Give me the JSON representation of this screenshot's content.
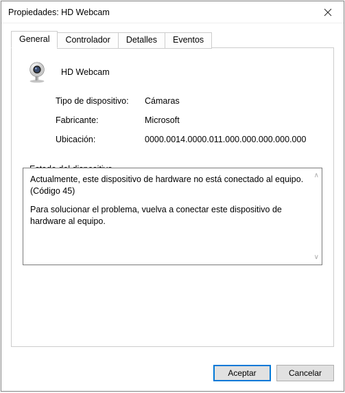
{
  "window": {
    "title": "Propiedades: HD Webcam"
  },
  "tabs": {
    "general": "General",
    "controller": "Controlador",
    "details": "Detalles",
    "events": "Eventos"
  },
  "device": {
    "name": "HD Webcam"
  },
  "props": {
    "type_label": "Tipo de dispositivo:",
    "type_value": "Cámaras",
    "manufacturer_label": "Fabricante:",
    "manufacturer_value": "Microsoft",
    "location_label": "Ubicación:",
    "location_value": "0000.0014.0000.011.000.000.000.000.000"
  },
  "status": {
    "fieldset_label": "Estado del dispositivo",
    "line1": "Actualmente, este dispositivo de hardware no está conectado al equipo. (Código 45)",
    "line2": "Para solucionar el problema, vuelva a conectar este dispositivo de hardware al equipo."
  },
  "buttons": {
    "ok": "Aceptar",
    "cancel": "Cancelar"
  }
}
